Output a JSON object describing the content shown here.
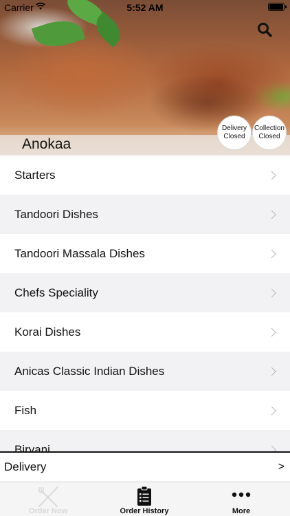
{
  "status_bar": {
    "carrier": "Carrier",
    "time": "5:52 AM"
  },
  "header": {
    "restaurant_name": "Anokaa",
    "search_icon": "search-icon",
    "delivery_badge": {
      "line1": "Delivery",
      "line2": "Closed"
    },
    "collection_badge": {
      "line1": "Collection",
      "line2": "Closed"
    }
  },
  "menu": {
    "categories": [
      {
        "label": "Starters"
      },
      {
        "label": "Tandoori Dishes"
      },
      {
        "label": "Tandoori Massala Dishes"
      },
      {
        "label": "Chefs Speciality"
      },
      {
        "label": "Korai Dishes"
      },
      {
        "label": "Anicas Classic Indian Dishes"
      },
      {
        "label": "Fish"
      },
      {
        "label": "Biryani"
      }
    ]
  },
  "order_bar": {
    "mode_label": "Delivery",
    "arrow": ">"
  },
  "tab_bar": {
    "tabs": [
      {
        "label": "Order Now",
        "icon": "fork-knife-icon",
        "state": "disabled"
      },
      {
        "label": "Order History",
        "icon": "clipboard-list-icon",
        "state": "normal"
      },
      {
        "label": "More",
        "icon": "ellipsis-icon",
        "state": "normal"
      }
    ]
  },
  "colors": {
    "row_alt": "#f2f2f4",
    "tab_bar_bg": "#f5f5f5",
    "disabled_tab": "#d8d8d8"
  }
}
